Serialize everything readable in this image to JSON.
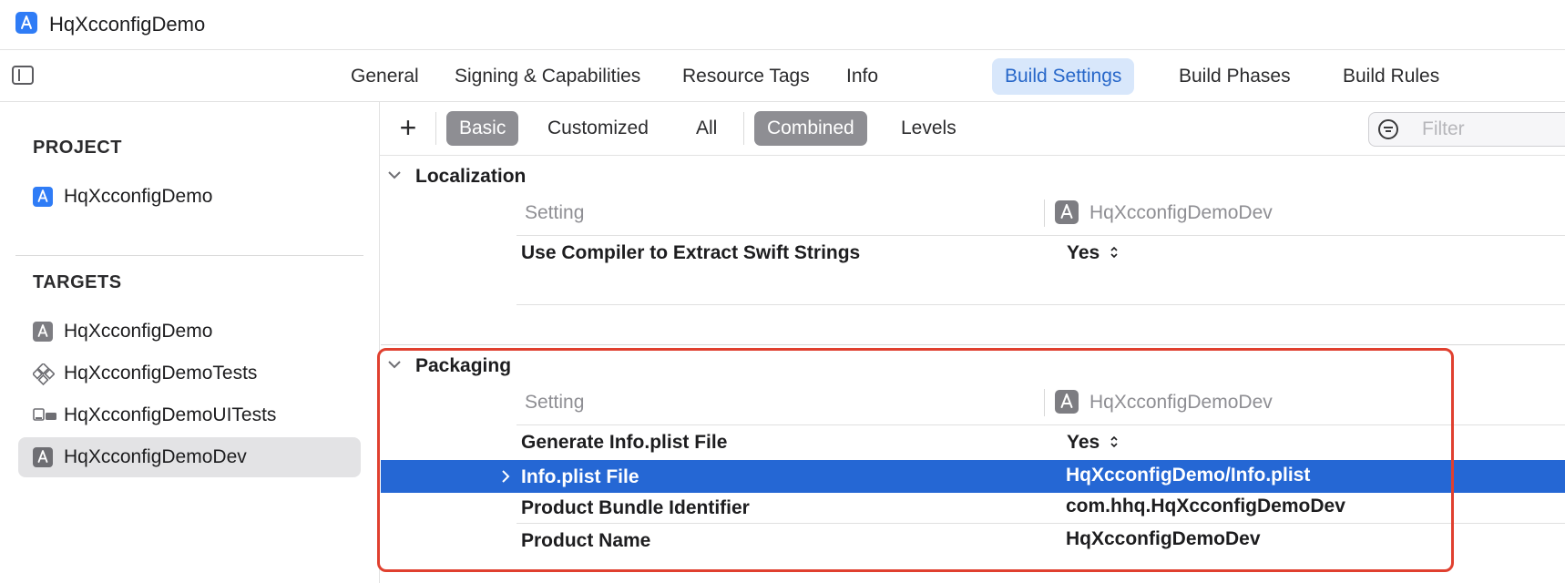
{
  "window": {
    "title": "HqXcconfigDemo"
  },
  "tabs": [
    {
      "label": "General"
    },
    {
      "label": "Signing & Capabilities"
    },
    {
      "label": "Resource Tags"
    },
    {
      "label": "Info"
    },
    {
      "label": "Build Settings"
    },
    {
      "label": "Build Phases"
    },
    {
      "label": "Build Rules"
    }
  ],
  "active_tab": "Build Settings",
  "sidebar": {
    "project_header": "PROJECT",
    "project_item": "HqXcconfigDemo",
    "targets_header": "TARGETS",
    "targets": [
      {
        "label": "HqXcconfigDemo"
      },
      {
        "label": "HqXcconfigDemoTests"
      },
      {
        "label": "HqXcconfigDemoUITests"
      },
      {
        "label": "HqXcconfigDemoDev"
      }
    ],
    "selected_target": "HqXcconfigDemoDev"
  },
  "toolbar": {
    "add_icon": "plus-icon",
    "scope_filters": [
      {
        "label": "Basic"
      },
      {
        "label": "Customized"
      },
      {
        "label": "All"
      }
    ],
    "active_scope": "Basic",
    "view_modes": [
      {
        "label": "Combined"
      },
      {
        "label": "Levels"
      }
    ],
    "active_view": "Combined",
    "filter_placeholder": "Filter"
  },
  "groups": {
    "localization": {
      "title": "Localization",
      "col_setting": "Setting",
      "col_target": "HqXcconfigDemoDev",
      "rows": [
        {
          "name": "Use Compiler to Extract Swift Strings",
          "value": "Yes"
        }
      ]
    },
    "packaging": {
      "title": "Packaging",
      "col_setting": "Setting",
      "col_target": "HqXcconfigDemoDev",
      "rows": [
        {
          "name": "Generate Info.plist File",
          "value": "Yes"
        },
        {
          "name": "Info.plist File",
          "value": "HqXcconfigDemo/Info.plist"
        },
        {
          "name": "Product Bundle Identifier",
          "value": "com.hhq.HqXcconfigDemoDev"
        },
        {
          "name": "Product Name",
          "value": "HqXcconfigDemoDev"
        }
      ],
      "selected_row": "Info.plist File"
    }
  },
  "colors": {
    "accent": "#2567d4",
    "active_tab_bg": "#d8e7fb",
    "highlight_box": "#e0402f"
  }
}
